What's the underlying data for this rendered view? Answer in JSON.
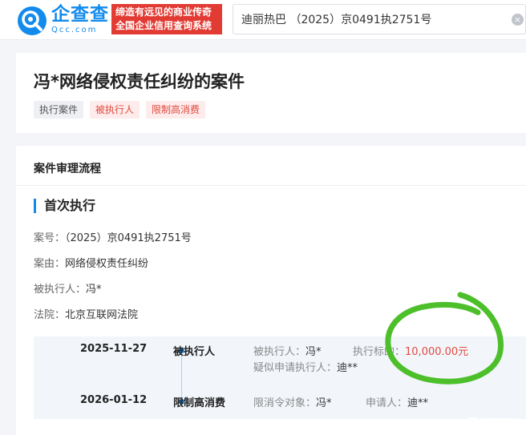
{
  "header": {
    "brand_name": "企查查",
    "brand_domain": "Qcc.com",
    "slogan_line1": "缔造有远见的商业传奇",
    "slogan_line2": "全国企业信用查询系统",
    "search_value": "迪丽热巴 （2025）京0491执2751号",
    "clear_glyph": "×"
  },
  "case": {
    "title": "冯*网络侵权责任纠纷的案件",
    "tags": [
      {
        "label": "执行案件"
      },
      {
        "label": "被执行人"
      },
      {
        "label": "限制高消费"
      }
    ]
  },
  "process": {
    "section_title": "案件审理流程",
    "stage_title": "首次执行",
    "fields": {
      "case_no_label": "案号：",
      "case_no_value": "（2025）京0491执2751号",
      "cause_label": "案由：",
      "cause_value": "网络侵权责任纠纷",
      "executed_label": "被执行人：",
      "executed_value": "冯*",
      "court_label": "法院：",
      "court_value": "北京互联网法院"
    },
    "timeline": [
      {
        "date": "2025-11-27",
        "event": "被执行人",
        "d1_label": "被执行人：",
        "d1_value": "冯*",
        "d2_label": "执行标的：",
        "d2_value": "10,000.00元",
        "d3_label": "疑似申请执行人：",
        "d3_value": "迪**"
      },
      {
        "date": "2026-01-12",
        "event": "限制高消费",
        "d1_label": "限消令对象：",
        "d1_value": "冯*",
        "d2_label": "申请人：",
        "d2_value": "迪**"
      }
    ]
  },
  "colors": {
    "brand_blue": "#128bed",
    "slogan_red": "#e23b34",
    "amount_red": "#e0493f",
    "annotation_green": "#4cbf2a"
  },
  "icons": {
    "logo": "qcc-logo-icon",
    "clear": "clear-icon",
    "timeline_dot": "timeline-dot-icon"
  }
}
